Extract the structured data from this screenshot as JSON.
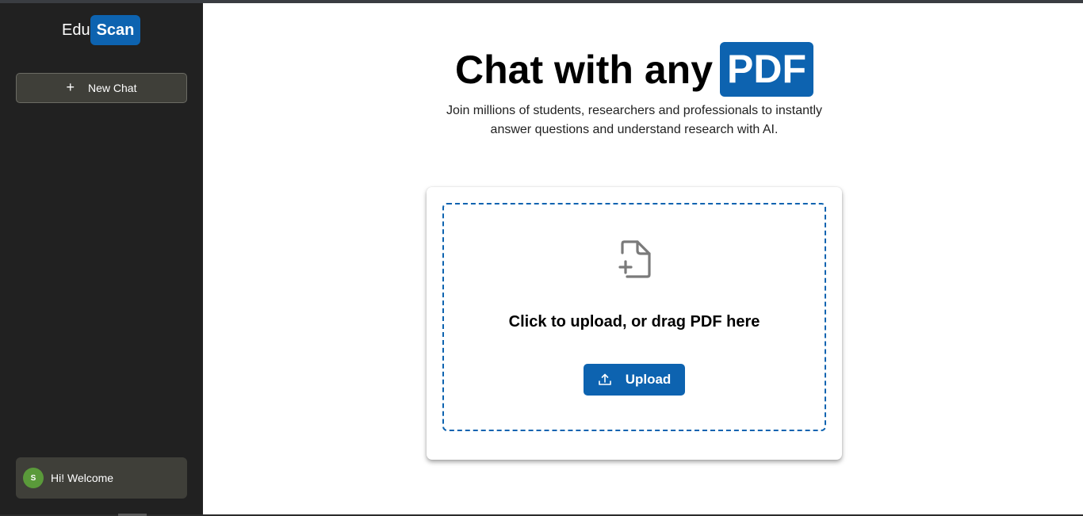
{
  "sidebar": {
    "logo_prefix": "Edu",
    "logo_highlight": "Scan",
    "new_chat_icon": "+",
    "new_chat_label": "New Chat",
    "user": {
      "avatar_initial": "S",
      "greeting": "Hi! Welcome"
    }
  },
  "main": {
    "headline": "Chat with any",
    "headline_highlight": "PDF",
    "subtitle_line1": "Join millions of students, researchers and professionals to instantly",
    "subtitle_line2": "answer questions and understand research with AI.",
    "upload_card": {
      "icon": "file-plus-icon",
      "prompt": "Click to upload, or drag PDF here",
      "button_label": "Upload",
      "button_icon": "upload-icon"
    }
  },
  "colors": {
    "accent": "#0d63b0",
    "sidebar_bg": "#212121",
    "sidebar_button_bg": "#3f3f39",
    "avatar_bg": "#5a9a3a"
  }
}
